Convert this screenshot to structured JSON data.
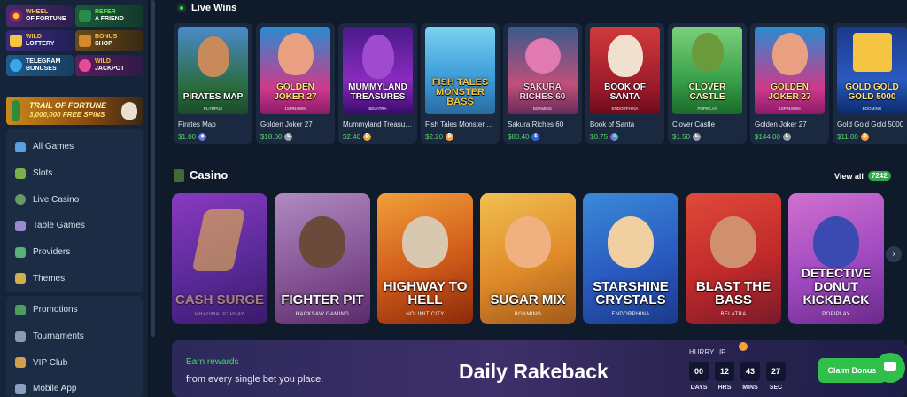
{
  "sidebar": {
    "promos": [
      {
        "line1": "Wheel",
        "line2": "of Fortune",
        "icon": "wheel-icon"
      },
      {
        "line1": "Refer",
        "line2": "a Friend",
        "icon": "refer-icon"
      },
      {
        "line1": "Wild",
        "line2": "Lottery",
        "icon": "lottery-icon"
      },
      {
        "line1": "Bonus",
        "line2": "Shop",
        "icon": "shop-icon"
      },
      {
        "line1": "Telegram",
        "line2": "Bonuses",
        "icon": "telegram-icon"
      },
      {
        "line1": "Wild",
        "line2": "Jackpot",
        "icon": "jackpot-icon"
      }
    ],
    "trail": {
      "line1": "Trail of Fortune",
      "line2": "3,000,000 Free Spins"
    },
    "nav_games": [
      {
        "label": "All Games",
        "icon": "grid-icon"
      },
      {
        "label": "Slots",
        "icon": "slots-icon"
      },
      {
        "label": "Live Casino",
        "icon": "live-casino-icon"
      },
      {
        "label": "Table Games",
        "icon": "table-games-icon"
      },
      {
        "label": "Providers",
        "icon": "providers-icon"
      },
      {
        "label": "Themes",
        "icon": "themes-icon"
      }
    ],
    "nav_more": [
      {
        "label": "Promotions",
        "icon": "promotions-icon"
      },
      {
        "label": "Tournaments",
        "icon": "trophy-icon"
      },
      {
        "label": "VIP Club",
        "icon": "vip-icon"
      },
      {
        "label": "Mobile App",
        "icon": "mobile-icon"
      }
    ]
  },
  "live_wins": {
    "title": "Live Wins",
    "items": [
      {
        "game": "Pirates Map",
        "art_title": "Pirates Map",
        "provider": "Platipus",
        "amount": "$1.00",
        "coin": "eth"
      },
      {
        "game": "Golden Joker 27",
        "art_title": "Golden Joker 27",
        "provider": "1Spin4Win",
        "amount": "$18.00",
        "coin": "ltc"
      },
      {
        "game": "Mummyland Treasures",
        "art_title": "Mummyland Treasures",
        "provider": "Belatra",
        "amount": "$2.40",
        "coin": "btc"
      },
      {
        "game": "Fish Tales Monster Bass",
        "art_title": "Fish Tales Monster Bass",
        "provider": "",
        "amount": "$2.20",
        "coin": "btc"
      },
      {
        "game": "Sakura Riches 60",
        "art_title": "Sakura Riches 60",
        "provider": "BGaming",
        "amount": "$80.40",
        "coin": "usdc"
      },
      {
        "game": "Book of Santa",
        "art_title": "Book of Santa",
        "provider": "Endorphina",
        "amount": "$0.75",
        "coin": "sol"
      },
      {
        "game": "Clover Castle",
        "art_title": "Clover Castle",
        "provider": "PopiPlay",
        "amount": "$1.50",
        "coin": "ltc"
      },
      {
        "game": "Golden Joker 27",
        "art_title": "Golden Joker 27",
        "provider": "1Spin4Win",
        "amount": "$144.00",
        "coin": "ltc"
      },
      {
        "game": "Gold Gold Gold 5000",
        "art_title": "Gold Gold Gold 5000",
        "provider": "Booming",
        "amount": "$11.00",
        "coin": "btc"
      }
    ]
  },
  "casino": {
    "title": "Casino",
    "view_all": "View all",
    "count": "7242",
    "games": [
      {
        "title": "Cash Surge",
        "provider": "Pragmatic Play"
      },
      {
        "title": "Fighter Pit",
        "provider": "Hacksaw Gaming"
      },
      {
        "title": "Highway to Hell",
        "provider": "Nolimit City"
      },
      {
        "title": "Sugar Mix",
        "provider": "BGaming"
      },
      {
        "title": "Starshine Crystals",
        "provider": "Endorphina"
      },
      {
        "title": "Blast the Bass",
        "provider": "Belatra"
      },
      {
        "title": "Detective Donut Kickback",
        "provider": "PopiPlay"
      }
    ],
    "next_icon": "›"
  },
  "rakeback": {
    "earn": "Earn rewards",
    "subtitle": "from every single bet you place.",
    "title": "Daily Rakeback",
    "hurry": "HURRY UP",
    "timer": [
      {
        "value": "00",
        "label": "DAYS"
      },
      {
        "value": "12",
        "label": "HRS"
      },
      {
        "value": "43",
        "label": "MINS"
      },
      {
        "value": "27",
        "label": "SEC"
      }
    ],
    "claim": "Claim Bonus"
  },
  "colors": {
    "background": "#0f1a2b",
    "sidebar": "#16243a",
    "accent_green": "#2fbf4a",
    "win_green": "#5ad46a"
  }
}
